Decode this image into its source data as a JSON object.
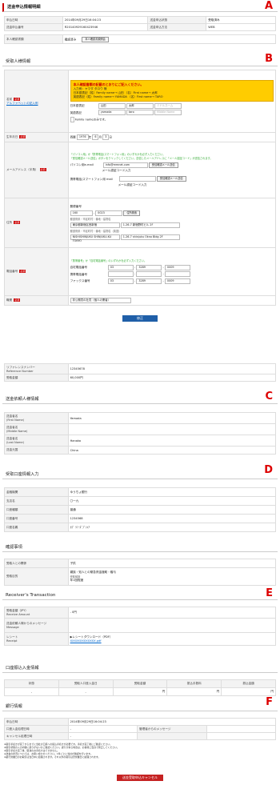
{
  "markers": [
    "A",
    "B",
    "C",
    "D",
    "E",
    "F"
  ],
  "sec_a": {
    "title": "送金申込情報明細",
    "rows": [
      {
        "l1": "申込日時",
        "v1": "2014年09月29日16:04:23",
        "l2": "送金申込状態",
        "v2": "受取済み"
      },
      {
        "l1": "送金申込番号",
        "v1": "R20140929160423946",
        "l2": "送金申込方法",
        "v2": "WEB"
      }
    ],
    "confirm_label": "本人確認書類",
    "confirm_value": "確認済み",
    "confirm_button": "本人確認書類照会"
  },
  "sec_b": {
    "title": "受取人様情報",
    "name_label": "名前",
    "required": "必須",
    "alpha_link": "アルファベットの記入例",
    "notice_title": "本人確認書類の記載のとおりにご記入ください。",
    "notice_lines": [
      "入力例：ヤマダ タロウ 様",
      "日本語表記（姓）Family name→ 山田 （名）First name→ 太郎",
      "英語表記（姓）Family name→ YAMADA （名）First name→ TARO"
    ],
    "jp_label": "日本語表記",
    "jp_family": "山田",
    "jp_first": "太郎",
    "jp_middle_ph": "ミドルネーム",
    "en_label": "英語表記",
    "en_family": "yamada",
    "en_first": "taro",
    "en_middle_ph": "Middle Name",
    "family_only": "Family nameのみです。",
    "dob_label": "生年月日",
    "dob_era": "西暦",
    "dob_year": "1976",
    "dob_month": "6",
    "dob_day": "3",
    "dob_units": [
      "年",
      "月",
      "日"
    ],
    "email_label": "メールアドレス（半角）",
    "email_note": "「パソコン用」か「携帯電話/スマートフォン用」のいずれかを必ず入力ください。",
    "email_note2": "「受信確認メール送信」ボタンをクリックしてください。送信したメールアドレスに「メール認証コード」が送信されます。",
    "pc_label": "パソコン用e-mail",
    "pc_value": "info@remnet.com",
    "send_button": "受信確認メール送信",
    "auth_label": "メール認証コード入力",
    "mobile_label": "携帯電話/スマートフォン用 mail",
    "mobile_send": "受信確認メール送信",
    "auth_label2": "メール認証コード入力",
    "addr_label": "住所",
    "zip_label": "郵便番号",
    "zip1": "160",
    "zip2": "0023",
    "zip_button": "住所検索",
    "addr_jp_label": "都道府県・市区町村・番地・建物名",
    "pref": "東京都新宿区西新宿",
    "street": "1-26-7 新宿野村ビル 2F",
    "addr_en_label": "都道府県・市区町村・番地・建物名（英語）",
    "pref_en": "NISHISHINJUKU SHINJUKU-KU TOKYO",
    "street_en": "1-26-7 shinjuku Okno Bldg 2F",
    "tel_label": "電話番号",
    "tel_note": "「携帯番号」か「自宅電話番号」のいずれかを必ず入力ください。",
    "home_label": "自宅電話番号",
    "home": [
      "03",
      "3289",
      "0009"
    ],
    "mobile_tel_label": "携帯電話番号",
    "fax_label": "ファックス番号",
    "fax": [
      "03",
      "3289",
      "0009"
    ],
    "occ_label": "職業",
    "occ_value": "非公務員の社員（個人の業者）",
    "submit": "修正"
  },
  "ref": {
    "l1": "リファレンスナンバー\nReference Number",
    "v1": "12345678",
    "l2": "受取金額",
    "v2": "60,000円"
  },
  "sec_c": {
    "title": "送金依頼人様情報",
    "rows": [
      {
        "l": "送金者名\n(First Name)",
        "v": "Yamada"
      },
      {
        "l": "送金者名\n(Middle Name)",
        "v": ""
      },
      {
        "l": "送金者名\n(Last Name)",
        "v": "Hanako"
      },
      {
        "l": "送金元国",
        "v": "China"
      }
    ]
  },
  "sec_d": {
    "title": "受取口座情報入力",
    "rows": [
      {
        "l": "金融機関",
        "v": "ゆうちょ銀行"
      },
      {
        "l": "支店名",
        "v": "〇一九"
      },
      {
        "l": "口座種類",
        "v": "普通"
      },
      {
        "l": "口座番号",
        "v": "1234568"
      },
      {
        "l": "口座名義",
        "v": "ｶﾌﾞ ﾘﾐｰｽﾞﾌﾟｼｬｱ"
      }
    ]
  },
  "sec_confirm": {
    "title": "確認事項",
    "r1l": "受取人との関係",
    "r1v": "子供",
    "r2l": "受取目的",
    "r2v": "親族・知人との緊急資金援助・贈与",
    "r2s": "受取頻度",
    "r2s2": "年1回程度"
  },
  "sec_e": {
    "title": "Receiver's Transaction",
    "rows": [
      {
        "l": "受取金額（JPY）\nReceive Amount",
        "v": "- 0円"
      },
      {
        "l": "送金依頼人様からのメッセージ\nMessage",
        "v": ""
      },
      {
        "l": "レシート\nReceipt",
        "v": "▶レシートダウンロード（PDF）"
      }
    ],
    "receipt_file": "XXXXXXXXXXXXX.pdf"
  },
  "bank_tx": {
    "title": "口座振込入金情報",
    "headers": [
      "状態",
      "受取人口座入金日",
      "受取金額",
      "振込手数料",
      "振込金額"
    ],
    "cells": [
      "-",
      "-",
      "円",
      "円",
      "円"
    ]
  },
  "sec_f": {
    "title": "銀行情報",
    "r1l": "申込日時",
    "r1v": "2014年09月29日16:04:23",
    "r2l": "口座入金処理日時",
    "r2v": "-",
    "r2l2": "管理者からのメッセージ",
    "r3l": "キャンセル処理日時",
    "r3v": "-",
    "notes": [
      "※取引手続きが完了するまでに当社の口座への振込手続きが必要です。手続き完了後にご確認ください。",
      "※取引状態の入力内容に誤りがないかご確認ください。誤りがある場合は、お客様ご自身で修正してください。",
      "※取引手続き完了後、取消のお手続きはできません。",
      "※送金の状況については、お問い合わせください。1件ごとに当社が確認を行います。",
      "※銀行営業日のお取引は当日中に処理されます。それ以外の取引は翌営業日に処理されます。"
    ],
    "cancel_button": "送金受取申込キャンセル"
  }
}
